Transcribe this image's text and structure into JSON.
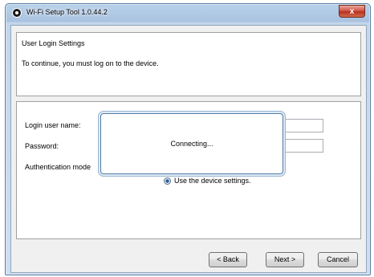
{
  "window": {
    "title": "Wi-Fi Setup Tool 1.0.44.2",
    "close_label": "x"
  },
  "header": {
    "title": "User Login Settings",
    "subtitle": "To continue, you must log on to the device."
  },
  "form": {
    "user_name_label": "Login user name:",
    "password_label": "Password:",
    "auth_mode_label": "Authentication mode",
    "radio_option_label": "Use the device settings.",
    "radio_option_selected": true
  },
  "dialog": {
    "message": "Connecting..."
  },
  "buttons": {
    "back": "< Back",
    "next": "Next >",
    "cancel": "Cancel"
  }
}
